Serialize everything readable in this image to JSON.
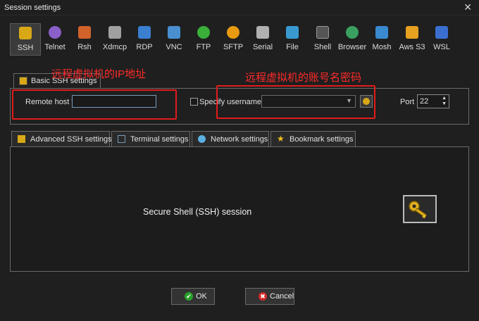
{
  "window": {
    "title": "Session settings",
    "close_glyph": "✕"
  },
  "toolbar": {
    "items": [
      {
        "label": "SSH",
        "icon": "ssh-key-icon",
        "color": "#d8a817",
        "active": true
      },
      {
        "label": "Telnet",
        "icon": "telnet-icon",
        "color": "#8a5fc8"
      },
      {
        "label": "Rsh",
        "icon": "rsh-icon",
        "color": "#d0622a"
      },
      {
        "label": "Xdmcp",
        "icon": "xdmcp-icon",
        "color": "#a0a0a0"
      },
      {
        "label": "RDP",
        "icon": "rdp-icon",
        "color": "#3a7fd0"
      },
      {
        "label": "VNC",
        "icon": "vnc-icon",
        "color": "#4a8fd0"
      },
      {
        "label": "FTP",
        "icon": "ftp-icon",
        "color": "#3ab03a"
      },
      {
        "label": "SFTP",
        "icon": "sftp-icon",
        "color": "#e89a10"
      },
      {
        "label": "Serial",
        "icon": "serial-icon",
        "color": "#b0b0b0"
      },
      {
        "label": "File",
        "icon": "file-icon",
        "color": "#3a9ad0"
      },
      {
        "label": "Shell",
        "icon": "shell-icon",
        "color": "#555555"
      },
      {
        "label": "Browser",
        "icon": "browser-icon",
        "color": "#3aa060"
      },
      {
        "label": "Mosh",
        "icon": "mosh-icon",
        "color": "#3a8ad0"
      },
      {
        "label": "Aws S3",
        "icon": "aws-s3-icon",
        "color": "#e8a020"
      },
      {
        "label": "WSL",
        "icon": "wsl-icon",
        "color": "#3a6fd0"
      }
    ]
  },
  "basic": {
    "tab_label": "Basic SSH settings",
    "remote_host_label": "Remote host *",
    "remote_host_value": "",
    "specify_username_label": "Specify username",
    "username_value": "",
    "port_label": "Port",
    "port_value": "22"
  },
  "annotations": {
    "host_note": "远程虚拟机的IP地址",
    "user_note": "远程虚拟机的账号名密码"
  },
  "tabs": [
    {
      "label": "Advanced SSH settings",
      "icon": "ssh-key-icon",
      "color": "#d8a817"
    },
    {
      "label": "Terminal settings",
      "icon": "terminal-icon",
      "color": "#7a9ab8"
    },
    {
      "label": "Network settings",
      "icon": "network-icon",
      "color": "#5ab0e0"
    },
    {
      "label": "Bookmark settings",
      "icon": "star-icon",
      "color": "#f0c020"
    }
  ],
  "panel": {
    "text": "Secure Shell (SSH) session"
  },
  "buttons": {
    "ok_label": "OK",
    "ok_glyph": "✔",
    "ok_color": "#2aa02a",
    "cancel_label": "Cancel",
    "cancel_glyph": "✖",
    "cancel_color": "#d02a2a"
  }
}
